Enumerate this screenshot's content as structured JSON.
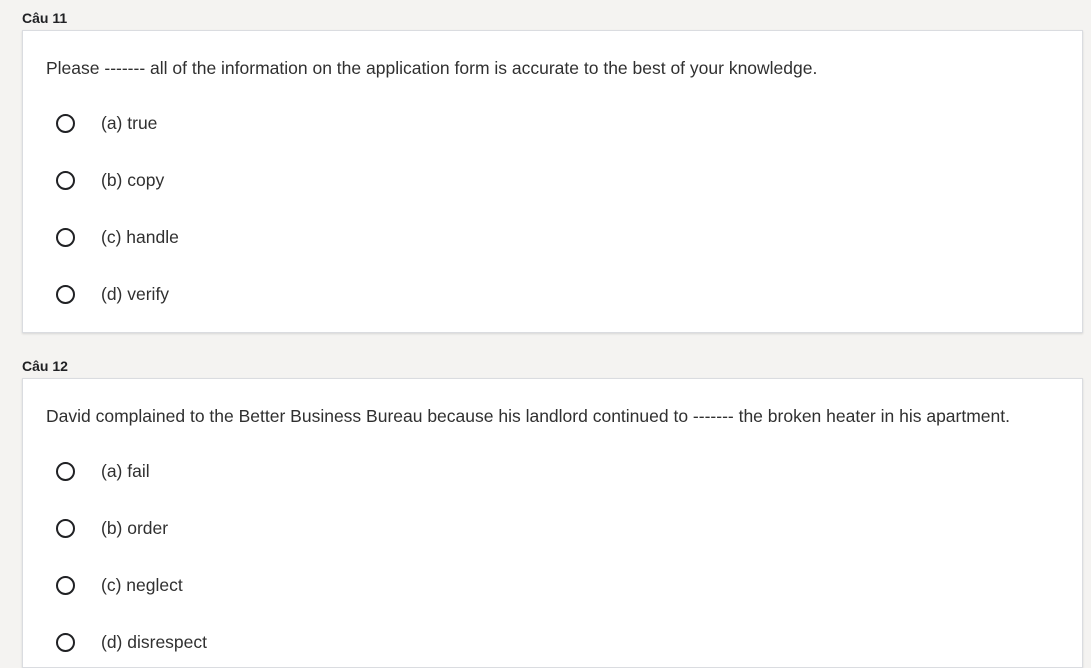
{
  "questions": [
    {
      "label": "Câu 11",
      "text": "Please ------- all of the information on the application form is accurate to the best of your knowledge.",
      "options": [
        "(a) true",
        "(b) copy",
        "(c) handle",
        "(d) verify"
      ]
    },
    {
      "label": "Câu 12",
      "text": "David complained to the Better Business Bureau because his landlord continued to ------- the broken heater in his apartment.",
      "options": [
        "(a) fail",
        "(b) order",
        "(c) neglect",
        "(d) disrespect"
      ]
    }
  ],
  "icons": {
    "radio": "radio-unchecked-icon"
  }
}
